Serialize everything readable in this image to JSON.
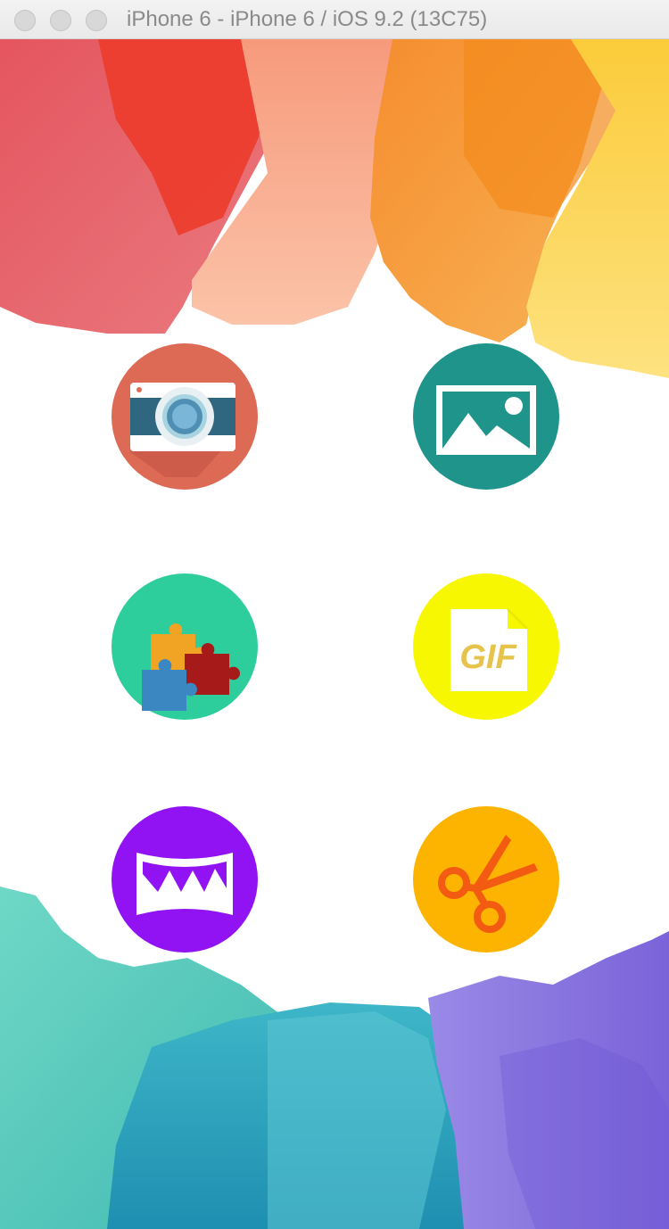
{
  "window": {
    "title": "iPhone 6 - iPhone 6 / iOS 9.2 (13C75)"
  },
  "colors": {
    "camera": "#dc6a55",
    "gallery": "#1f948b",
    "puzzle": "#2ecd9c",
    "gif": "#f7f702",
    "panorama": "#9113f3",
    "scissors": "#fdb400"
  },
  "buttons": {
    "camera": {
      "icon": "camera-icon"
    },
    "gallery": {
      "icon": "image-icon"
    },
    "puzzle": {
      "icon": "puzzle-icon"
    },
    "gif": {
      "icon": "gif-file-icon",
      "label": "GIF"
    },
    "panorama": {
      "icon": "panorama-icon"
    },
    "scissors": {
      "icon": "scissors-icon"
    }
  }
}
